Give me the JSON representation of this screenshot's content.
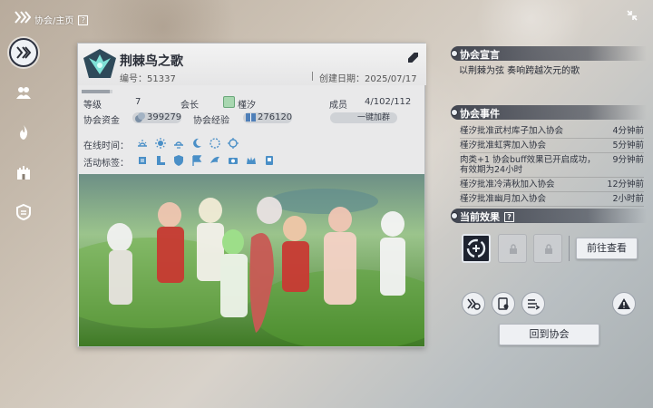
{
  "topbar": {
    "breadcrumb": "协会/主页",
    "help": "?"
  },
  "guild": {
    "name": "荆棘鸟之歌",
    "id_label": "编号：51337",
    "created_label": "创建日期：2025/07/17",
    "exp_progress": 0.9
  },
  "stats": {
    "level_label": "等级",
    "level_value": "7",
    "leader_label": "会长",
    "leader_value": "槿汐",
    "members_label": "成员",
    "members_value": "4/102/112",
    "funds_label": "协会资金",
    "funds_value": "399279",
    "exp_label": "协会经验",
    "exp_value": "276120",
    "join_group": "一键加群",
    "online_label": "在线时间：",
    "tags_label": "活动标签："
  },
  "right": {
    "declaration_title": "协会宣言",
    "declaration_text": "以荆棘为弦 奏响跨越次元的歌",
    "events_title": "协会事件",
    "events": [
      {
        "text": "槿汐批准武村库子加入协会",
        "time": "4分钟前"
      },
      {
        "text": "槿汐批准虹霁加入协会",
        "time": "5分钟前"
      },
      {
        "text": "肉类+1 协会buff效果已开启成功，有效期为24小时",
        "time": "9分钟前"
      },
      {
        "text": "槿汐批准冷清秋加入协会",
        "time": "12分钟前"
      },
      {
        "text": "槿汐批准幽月加入协会",
        "time": "2小时前"
      }
    ],
    "effects_title": "当前效果",
    "effects_help": "?",
    "goto_label": "前往查看",
    "return_label": "回到协会"
  },
  "colors": {
    "accent": "#2a2e38",
    "panel": "#e9e9ea",
    "header_bar": "#282e3c"
  }
}
